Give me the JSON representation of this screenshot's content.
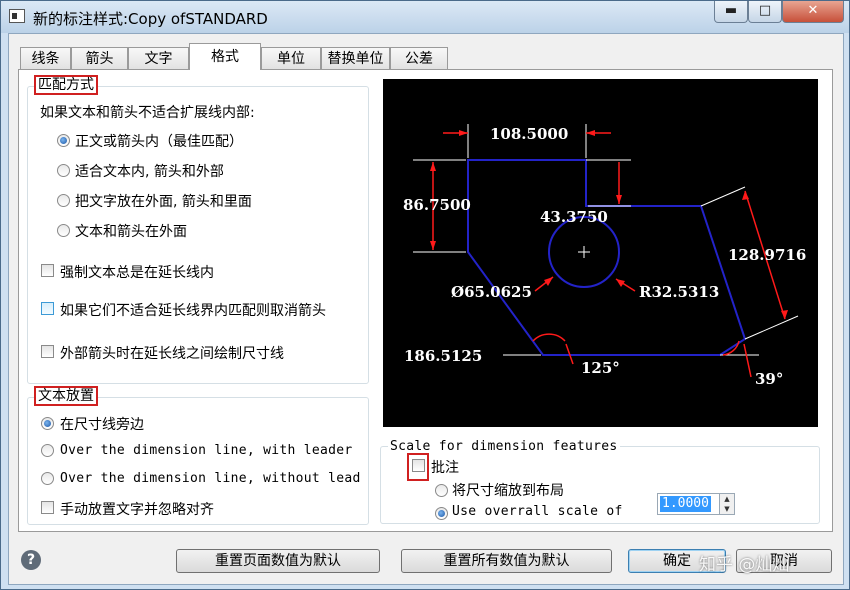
{
  "window": {
    "title": "新的标注样式:Copy ofSTANDARD",
    "minimize_icon": "minimize-icon",
    "maximize_icon": "maximize-icon",
    "close_icon": "close-icon",
    "min_glyph": "▬",
    "max_glyph": "□",
    "close_glyph": "✕"
  },
  "tabs": [
    "线条",
    "箭头",
    "文字",
    "格式",
    "单位",
    "替换单位",
    "公差"
  ],
  "active_tab": "格式",
  "fit": {
    "legend": "匹配方式",
    "prompt": "如果文本和箭头不适合扩展线内部:",
    "options": [
      "正文或箭头内（最佳匹配）",
      "适合文本内, 箭头和外部",
      "把文字放在外面, 箭头和里面",
      "文本和箭头在外面"
    ],
    "selected_index": 0,
    "checkboxes": [
      {
        "label": "强制文本总是在延长线内",
        "checked": false
      },
      {
        "label": "如果它们不适合延长线界内匹配则取消箭头",
        "checked": false
      },
      {
        "label": "外部箭头时在延长线之间绘制尺寸线",
        "checked": false
      }
    ]
  },
  "text_placement": {
    "legend": "文本放置",
    "options": [
      "在尺寸线旁边",
      "Over the dimension line, with leader",
      "Over the dimension line, without leader"
    ],
    "selected_index": 0,
    "manual_label": "手动放置文字并忽略对齐",
    "manual_checked": false
  },
  "scale": {
    "legend": "Scale for dimension features",
    "annotative_label": "批注",
    "annotative_checked": false,
    "options": [
      "将尺寸缩放到布局",
      "Use overrall scale of"
    ],
    "selected_index": 1,
    "value": "1.0000"
  },
  "preview": {
    "dims": [
      "108.5000",
      "86.7500",
      "43.3750",
      "Ø65.0625",
      "R32.5313",
      "128.9716",
      "186.5125",
      "125°",
      "39°"
    ],
    "colors": {
      "outline": "#2323c8",
      "dim": "#ffffff",
      "arrow": "#ff1a1a",
      "bg": "#000000"
    }
  },
  "buttons": {
    "reset_page": "重置页面数值为默认",
    "reset_all": "重置所有数值为默认",
    "ok": "确定",
    "cancel": "取消"
  },
  "help_icon": "help-icon",
  "help_glyph": "?",
  "watermark": "知乎 @灿灿"
}
